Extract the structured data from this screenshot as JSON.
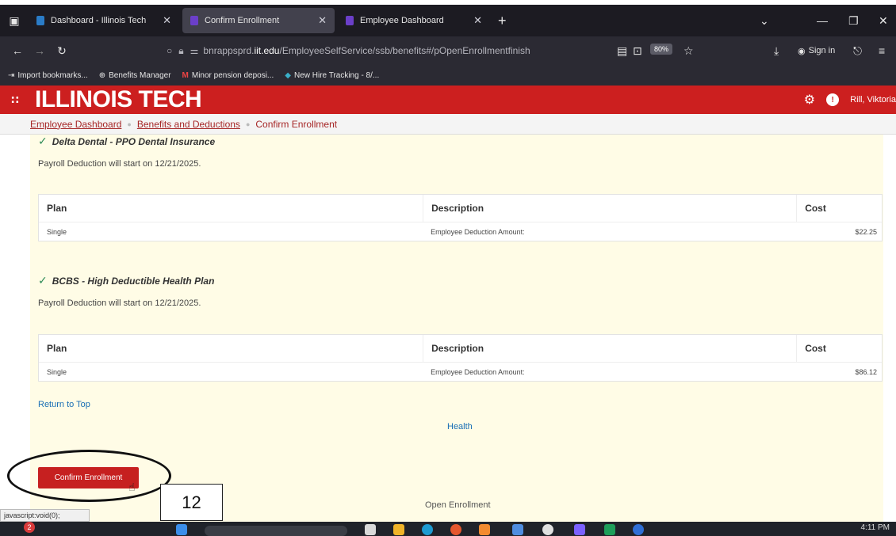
{
  "browser": {
    "tabs": [
      {
        "label": "Dashboard - Illinois Tech",
        "active": false
      },
      {
        "label": "Confirm Enrollment",
        "active": true
      },
      {
        "label": "Employee Dashboard",
        "active": false
      }
    ],
    "url_prefix": "bnrappsprd.",
    "url_host": "iit.edu",
    "url_path": "/EmployeeSelfService/ssb/benefits#/pOpenEnrollmentfinish",
    "zoom": "80%",
    "sign_in": "Sign in",
    "bookmarks": [
      "Import bookmarks...",
      "Benefits Manager",
      "Minor pension deposi...",
      "New Hire Tracking - 8/..."
    ]
  },
  "site": {
    "logo": "ILLINOIS TECH",
    "user_name": "Rill, Viktoria"
  },
  "breadcrumb": {
    "items": [
      "Employee Dashboard",
      "Benefits and Deductions"
    ],
    "current": "Confirm Enrollment"
  },
  "sections": [
    {
      "title": "Delta Dental - PPO Dental Insurance",
      "payroll_note": "Payroll Deduction will start on 12/21/2025.",
      "headers": {
        "plan": "Plan",
        "description": "Description",
        "cost": "Cost"
      },
      "row": {
        "plan": "Single",
        "description": "Employee Deduction Amount:",
        "cost": "$22.25"
      }
    },
    {
      "title": "BCBS - High Deductible Health Plan",
      "payroll_note": "Payroll Deduction will start on 12/21/2025.",
      "headers": {
        "plan": "Plan",
        "description": "Description",
        "cost": "Cost"
      },
      "row": {
        "plan": "Single",
        "description": "Employee Deduction Amount:",
        "cost": "$86.12"
      }
    }
  ],
  "links": {
    "return_top": "Return to Top",
    "health": "Health"
  },
  "confirm_button": "Confirm Enrollment",
  "footer": "Open Enrollment",
  "annotation_step": "12",
  "status_url": "javascript:void(0);",
  "taskbar": {
    "time": "4:11 PM",
    "notification_count": "2"
  },
  "colors": {
    "brand_red": "#cc1f1f",
    "content_bg": "#fffce6",
    "link_blue": "#1a6fb5"
  }
}
